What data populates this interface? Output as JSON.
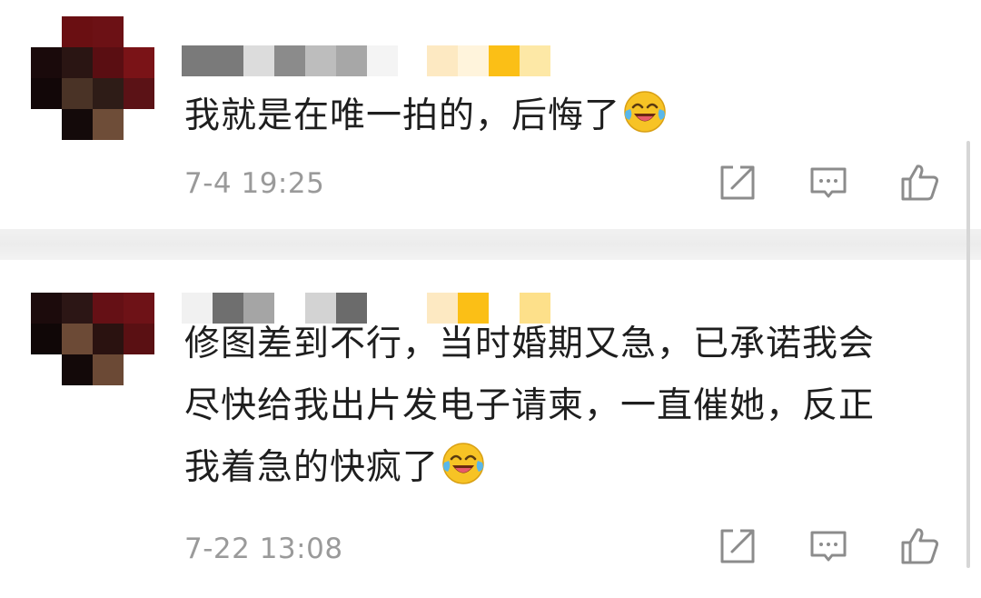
{
  "comments": [
    {
      "username": "",
      "text_lines": [
        "我就是在唯一拍的，后悔了"
      ],
      "emoji": "laughing-crying-emoji",
      "timestamp": "7-4 19:25",
      "actions": {
        "share_icon": "share-icon",
        "reply_icon": "comment-icon",
        "like_icon": "thumbs-up-icon"
      }
    },
    {
      "username": "",
      "text_lines": [
        "修图差到不行，当时婚期又急，已承诺我会",
        "尽快给我出片发电子请柬，一直催她，反正",
        "我着急的快疯了"
      ],
      "emoji": "laughing-crying-emoji",
      "timestamp": "7-22 13:08",
      "actions": {
        "share_icon": "share-icon",
        "reply_icon": "comment-icon",
        "like_icon": "thumbs-up-icon"
      }
    }
  ],
  "colors": {
    "text": "#1e1e1e",
    "meta": "#9a9a9a",
    "icon": "#8c8c8c",
    "separator": "#eeeeee",
    "emoji_face": "#f7c325"
  }
}
